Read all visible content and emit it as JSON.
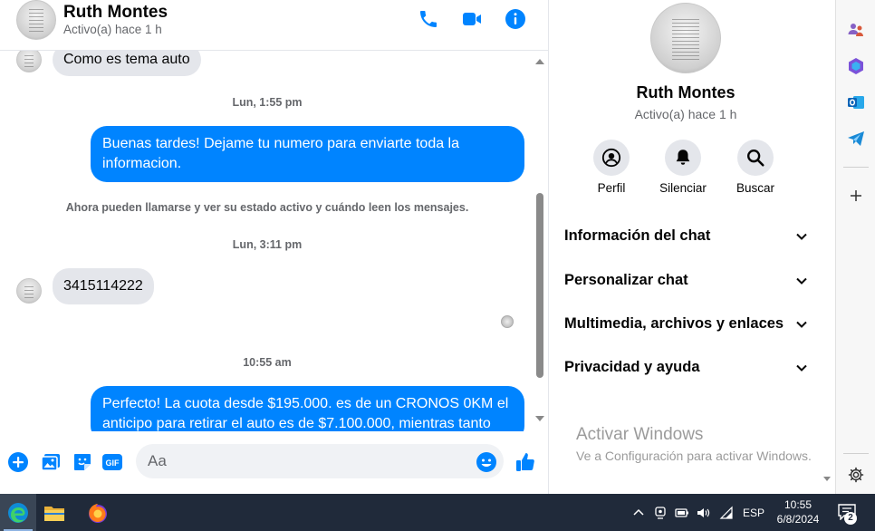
{
  "header": {
    "name": "Ruth Montes",
    "status": "Activo(a) hace 1 h"
  },
  "messages": {
    "partial_incoming": "Como es tema auto",
    "ts1": "Lun, 1:55 pm",
    "out1": "Buenas tardes! Dejame tu numero para enviarte toda la informacion.",
    "system_note": "Ahora pueden llamarse y ver su estado activo y cuándo leen los mensajes.",
    "ts2": "Lun, 3:11 pm",
    "in2": "3415114222",
    "ts3": "10:55 am",
    "out2": "Perfecto! La cuota desde $195.000. es de un CRONOS 0KM el anticipo para retirar el auto es de $7.100.000, mientras tanto"
  },
  "composer": {
    "placeholder": "Aa"
  },
  "panel": {
    "name": "Ruth Montes",
    "status": "Activo(a) hace 1 h",
    "actions": [
      {
        "label": "Perfil",
        "icon": "profile-icon"
      },
      {
        "label": "Silenciar",
        "icon": "bell-icon"
      },
      {
        "label": "Buscar",
        "icon": "search-icon"
      }
    ],
    "sections": [
      {
        "label": "Información del chat"
      },
      {
        "label": "Personalizar chat"
      },
      {
        "label": "Multimedia, archivos y enlaces"
      },
      {
        "label": "Privacidad y ayuda"
      }
    ],
    "watermark_title": "Activar Windows",
    "watermark_sub": "Ve a Configuración para activar Windows."
  },
  "taskbar": {
    "language": "ESP",
    "time": "10:55",
    "date": "6/8/2024",
    "notification_count": "2"
  },
  "colors": {
    "accent": "#0084ff",
    "incoming_bubble": "#e4e6eb",
    "taskbar": "#202a3a"
  }
}
